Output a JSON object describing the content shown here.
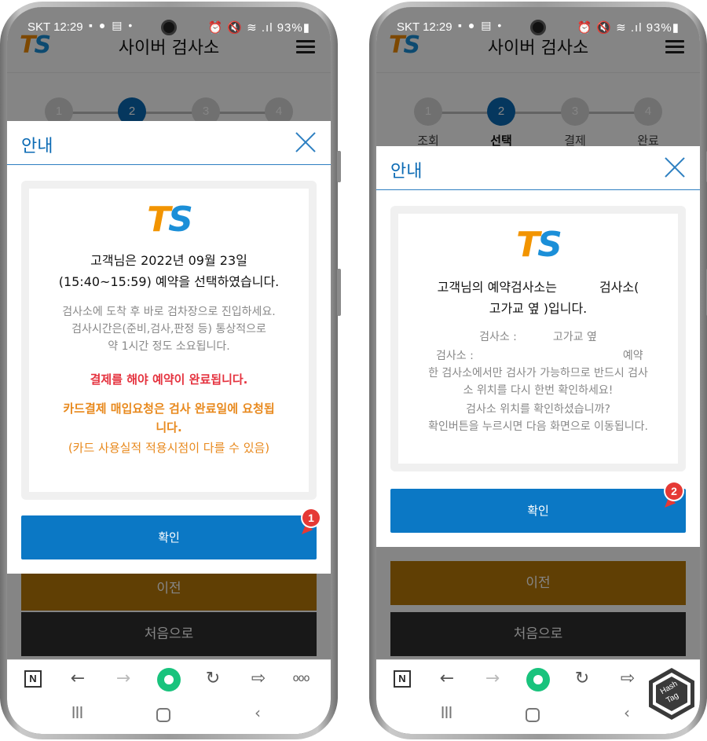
{
  "status_bar": {
    "carrier_time": "SKT 12:29",
    "notif_icons": "▪ ● ▤ •",
    "right_icons": "⏰ 🔇 ≋ .ıl 93%▮"
  },
  "page": {
    "logo_t": "T",
    "logo_s": "S",
    "title": "사이버 검사소",
    "steps": [
      {
        "num": "1",
        "label": "조회"
      },
      {
        "num": "2",
        "label": "선택"
      },
      {
        "num": "3",
        "label": "결제"
      },
      {
        "num": "4",
        "label": "완료"
      }
    ],
    "prev_label": "이전",
    "first_label": "처음으로"
  },
  "left_modal": {
    "title": "안내",
    "logo_t": "T",
    "logo_s": "S",
    "line1": "고객님은 2022년 09월 23일",
    "line2": "(15:40~15:59) 예약을 선택하였습니다.",
    "sub1": "검사소에 도착 후 바로 검차장으로 진입하세요.",
    "sub2": "검사시간은(준비,검사,판정 등) 통상적으로",
    "sub3": "약 1시간 정도 소요됩니다.",
    "red": "결제를 해야 예약이 완료됩니다.",
    "orange1": "카드결제 매입요청은 검사 완료일에 요청됩",
    "orange2": "니다.",
    "orange3": "(카드 사용실적 적용시점이 다를 수 있음)",
    "confirm": "확인",
    "marker": "1"
  },
  "right_modal": {
    "title": "안내",
    "logo_t": "T",
    "logo_s": "S",
    "line1_a": "고객님의 예약검사소는",
    "line1_b": "검사소(",
    "line2": "고가교 옆 )입니다.",
    "row1_label": "검사소 :",
    "row1_value": "고가교 옆",
    "row2_label": "검사소 :",
    "row2_value": "예약",
    "sub1": "한 검사소에서만 검사가 가능하므로 반드시 검사",
    "sub2": "소 위치를 다시 한번 확인하세요!",
    "sub3": "검사소 위치를 확인하셨습니까?",
    "sub4": "확인버튼을 누르시면 다음 화면으로 이동됩니다.",
    "confirm": "확인",
    "marker": "2"
  },
  "toolbar": {
    "n_label": "N",
    "back": "←",
    "forward": "→",
    "reload": "↻",
    "share": "⇨",
    "more": "ooo"
  },
  "navbar": {
    "recents": "III",
    "back": "‹"
  },
  "watermark": {
    "line1": "Hash",
    "line2": "Tag"
  }
}
